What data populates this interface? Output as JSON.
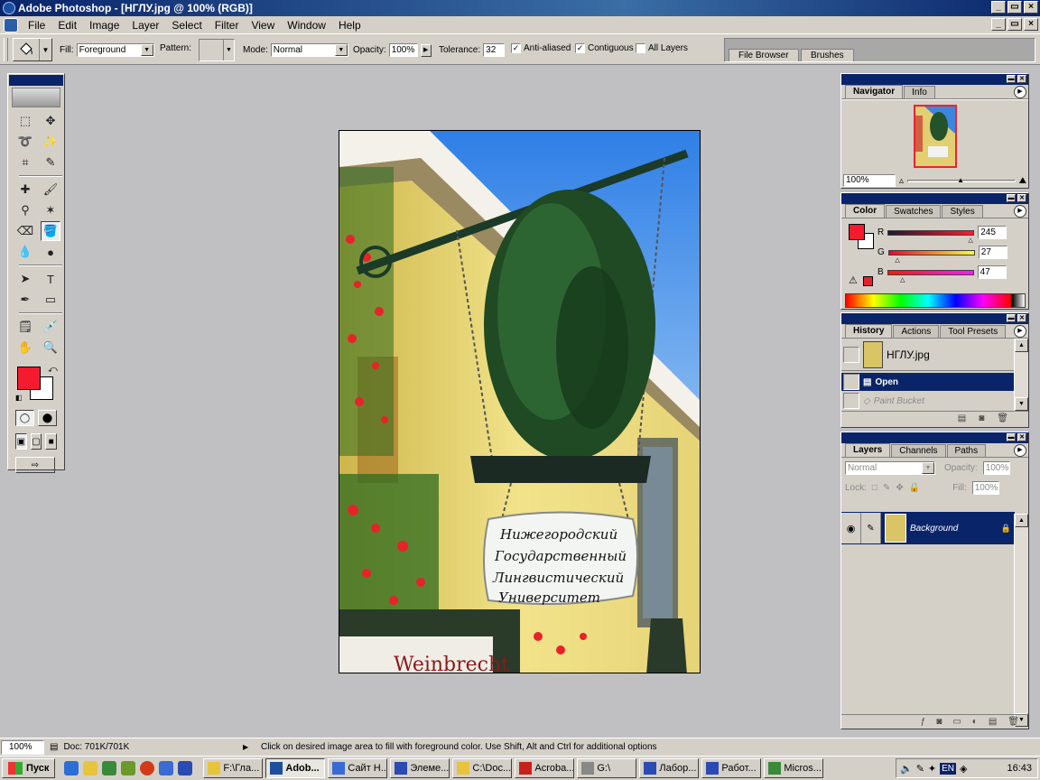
{
  "window": {
    "title": "Adobe Photoshop - [НГЛУ.jpg @ 100% (RGB)]",
    "controls": [
      "_",
      "▭",
      "×"
    ]
  },
  "menu": [
    "File",
    "Edit",
    "Image",
    "Layer",
    "Select",
    "Filter",
    "View",
    "Window",
    "Help"
  ],
  "options": {
    "fill_label": "Fill:",
    "fill_value": "Foreground",
    "pattern_label": "Pattern:",
    "mode_label": "Mode:",
    "mode_value": "Normal",
    "opacity_label": "Opacity:",
    "opacity_value": "100%",
    "tolerance_label": "Tolerance:",
    "tolerance_value": "32",
    "anti_aliased": "Anti-aliased",
    "contiguous": "Contiguous",
    "all_layers": "All Layers",
    "well_tabs": [
      "File Browser",
      "Brushes"
    ]
  },
  "toolbox": {
    "tools": [
      "⬚",
      "✥",
      "➰",
      "✨",
      "⌗",
      "✎",
      "✚",
      "🖌",
      "⚲",
      "✶",
      "⌫",
      "🪣",
      "💧",
      "●",
      "➤",
      "T",
      "✒",
      "▭",
      "🗒",
      "💉",
      "✋",
      "🔍"
    ],
    "active_index": 11,
    "foreground_color": "#f51b2f",
    "background_color": "#ffffff"
  },
  "navigator": {
    "tabs": [
      "Navigator",
      "Info"
    ],
    "zoom": "100%"
  },
  "color": {
    "tabs": [
      "Color",
      "Swatches",
      "Styles"
    ],
    "channels": [
      {
        "label": "R",
        "value": "245",
        "pos": 0.96
      },
      {
        "label": "G",
        "value": "27",
        "pos": 0.11
      },
      {
        "label": "B",
        "value": "47",
        "pos": 0.18
      }
    ]
  },
  "history": {
    "tabs": [
      "History",
      "Actions",
      "Tool Presets"
    ],
    "snapshot": "НГЛУ.jpg",
    "items": [
      "Open",
      "Paint Bucket"
    ]
  },
  "layers": {
    "tabs": [
      "Layers",
      "Channels",
      "Paths"
    ],
    "blend": "Normal",
    "opacity_label": "Opacity:",
    "opacity": "100%",
    "lock_label": "Lock:",
    "fill_label": "Fill:",
    "fill": "100%",
    "layer_name": "Background"
  },
  "canvas": {
    "sign_lines": [
      "Нижегородский",
      "Государственный",
      "Лингвистический",
      "Университет"
    ],
    "building_text": "Weinbrecht"
  },
  "status": {
    "zoom": "100%",
    "doc": "Doc: 701K/701K",
    "message": "Click on desired image area to fill with foreground color.  Use Shift, Alt and Ctrl for additional options"
  },
  "taskbar": {
    "start": "Пуск",
    "tasks": [
      "F:\\Гла...",
      "Adob...",
      "Сайт Н...",
      "Элеме...",
      "C:\\Doc...",
      "Acroba...",
      "G:\\",
      "Лабор...",
      "Работ...",
      "Micros..."
    ],
    "active_task": 1,
    "lang": "EN",
    "clock": "16:43"
  }
}
